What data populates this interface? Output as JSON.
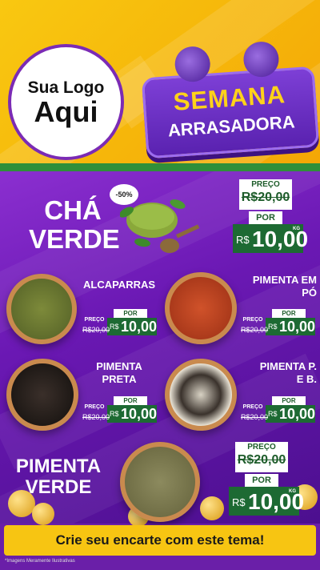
{
  "header": {
    "logo_line1": "Sua Logo",
    "logo_line2": "Aqui",
    "badge_line1": "SEMANA",
    "badge_line2": "ARRASADORA"
  },
  "featured": [
    {
      "name_line1": "CHÁ",
      "name_line2": "VERDE",
      "discount": "-50%",
      "price_label": "PREÇO",
      "old_price": "R$20,00",
      "por_label": "POR",
      "currency": "R$",
      "new_price": "10,00",
      "unit": "KG"
    },
    {
      "name_line1": "PIMENTA",
      "name_line2": "VERDE",
      "price_label": "PREÇO",
      "old_price": "R$20,00",
      "por_label": "POR",
      "currency": "R$",
      "new_price": "10,00",
      "unit": "KG"
    }
  ],
  "items": [
    {
      "name_line1": "ALCAPARRAS",
      "name_line2": "",
      "price_label": "PREÇO",
      "old_price": "R$20,00",
      "por_label": "POR",
      "currency": "R$",
      "new_price": "10,00"
    },
    {
      "name_line1": "PIMENTA EM",
      "name_line2": "PÓ",
      "price_label": "PREÇO",
      "old_price": "R$20,00",
      "por_label": "POR",
      "currency": "R$",
      "new_price": "10,00"
    },
    {
      "name_line1": "PIMENTA",
      "name_line2": "PRETA",
      "price_label": "PREÇO",
      "old_price": "R$20,00",
      "por_label": "POR",
      "currency": "R$",
      "new_price": "10,00"
    },
    {
      "name_line1": "PIMENTA P.",
      "name_line2": "E B.",
      "price_label": "PREÇO",
      "old_price": "R$20,00",
      "por_label": "POR",
      "currency": "R$",
      "new_price": "10,00"
    }
  ],
  "cta": "Crie seu encarte com este tema!",
  "disclaimer": "*Imagens Meramente Ilustrativas",
  "colors": {
    "header_yellow": "#f6b90b",
    "purple": "#6a18b3",
    "price_green": "#1d6a33",
    "cta_yellow": "#f7c512"
  }
}
